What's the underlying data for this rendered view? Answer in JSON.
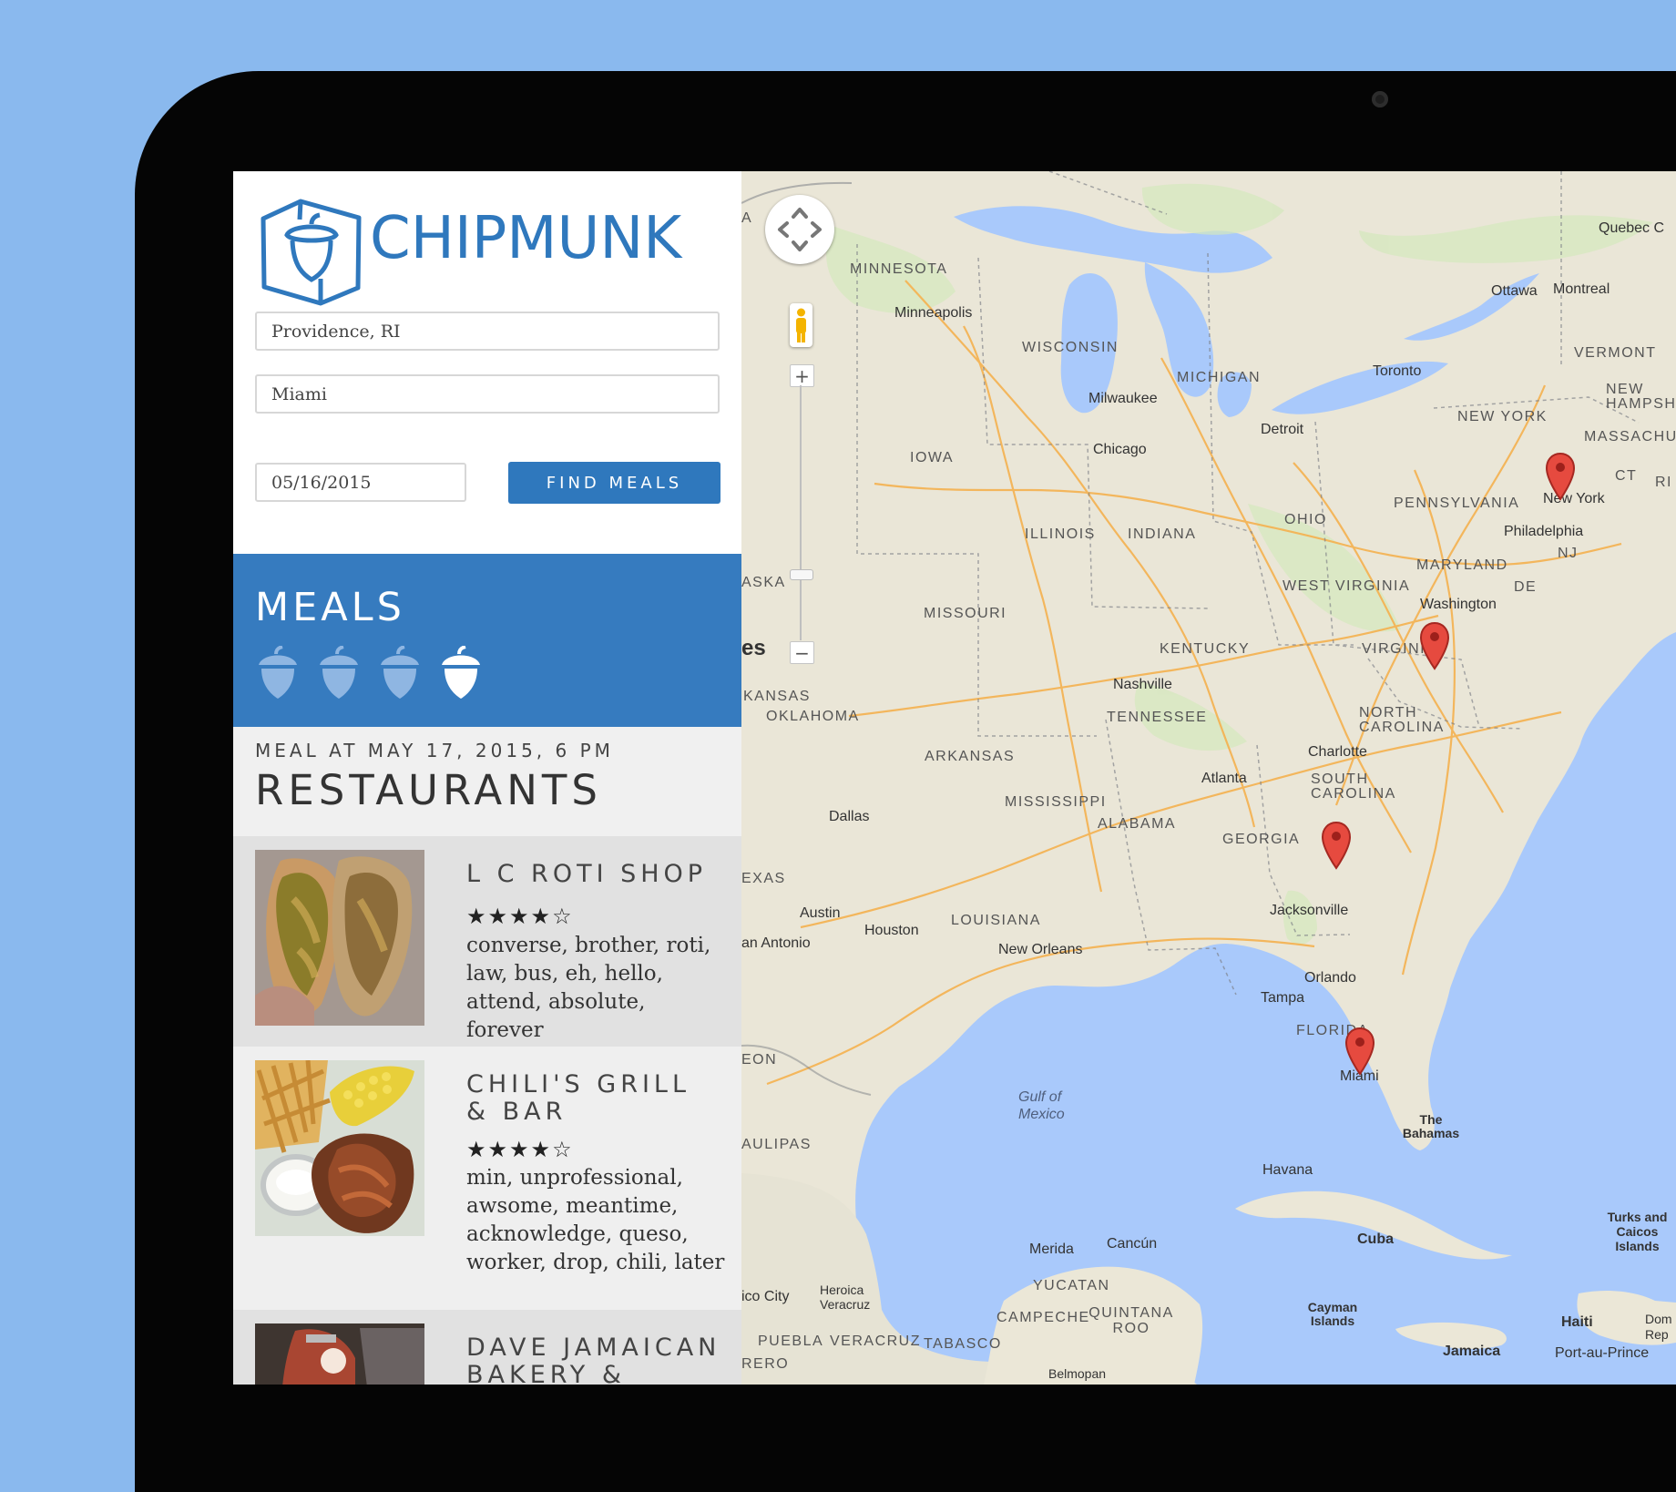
{
  "app": {
    "title": "CHIPMUNK"
  },
  "search": {
    "from": "Providence, RI",
    "to": "Miami",
    "date": "05/16/2015",
    "button": "FIND MEALS"
  },
  "meals": {
    "title": "MEALS",
    "acorn_count_total": 4,
    "acorn_selected_index": 3
  },
  "meal": {
    "label": "MEAL AT MAY 17, 2015, 6 PM",
    "title": "RESTAURANTS"
  },
  "restaurants": [
    {
      "name": "L C ROTI SHOP",
      "rating": "★★★★☆",
      "tags": "converse, brother, roti, law, bus, eh, hello, attend, absolute, forever"
    },
    {
      "name": "CHILI'S GRILL & BAR",
      "rating": "★★★★☆",
      "tags": "min, unprofessional, awsome, meantime, acknowledge, queso, worker, drop, chili, later"
    },
    {
      "name": "DAVE JAMAICAN BAKERY &",
      "rating": "",
      "tags": ""
    }
  ],
  "map": {
    "labels": [
      "Quebec C",
      "MINNESOTA",
      "Minneapolis",
      "WISCONSIN",
      "MICHIGAN",
      "Milwaukee",
      "IOWA",
      "Chicago",
      "Detroit",
      "Toronto",
      "Ottawa",
      "Montreal",
      "VERMONT",
      "NEW HAMPSHIR",
      "MASSACHUS",
      "NEW YORK",
      "CT",
      "RI",
      "New York",
      "PENNSYLVANIA",
      "Philadelphia",
      "OHIO",
      "ILLINOIS",
      "INDIANA",
      "MARYLAND",
      "NJ",
      "WEST VIRGINIA",
      "DE",
      "Washington",
      "MISSOURI",
      "KENTUCKY",
      "VIRGINIA",
      "Nashville",
      "OKLAHOMA",
      "TENNESSEE",
      "NORTH CAROLINA",
      "Charlotte",
      "ARKANSAS",
      "Atlanta",
      "SOUTH CAROLINA",
      "MISSISSIPPI",
      "ALABAMA",
      "GEORGIA",
      "Dallas",
      "EXAS",
      "Austin",
      "Houston",
      "an Antonio",
      "LOUISIANA",
      "New Orleans",
      "Jacksonville",
      "Orlando",
      "Tampa",
      "FLORIDA",
      "Miami",
      "EON",
      "Gulf of Mexico",
      "The Bahamas",
      "AULIPAS",
      "Havana",
      "Turks and Caicos Islands",
      "Merida",
      "Cancún",
      "Cuba",
      "YUCATAN",
      "Cayman Islands",
      "Heroica Veracruz",
      "ico City",
      "CAMPECHE",
      "QUINTANA ROO",
      "Haiti",
      "Dom Rep",
      "PUEBLA",
      "VERACRUZ",
      "TABASCO",
      "Jamaica",
      "Port-au-Prince",
      "RERO",
      "Belmopan",
      "ASKA",
      "KANSAS",
      "es",
      "A"
    ],
    "markers": [
      "New York",
      "Virginia",
      "Georgia coast",
      "Miami"
    ]
  }
}
